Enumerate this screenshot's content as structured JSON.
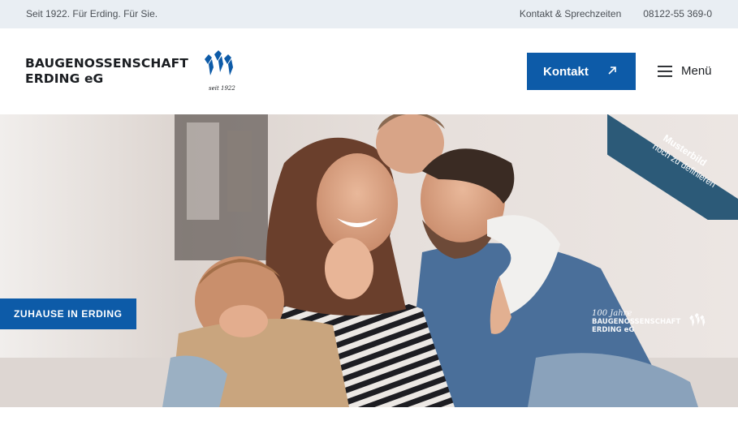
{
  "topbar": {
    "tagline": "Seit 1922. Für Erding. Für Sie.",
    "contact_link": "Kontakt & Sprechzeiten",
    "phone": "08122-55 369-0"
  },
  "header": {
    "brand_line1": "BAUGENOSSENSCHAFT",
    "brand_line2": "ERDING eG",
    "logo_caption": "seit 1922",
    "cta_label": "Kontakt",
    "menu_label": "Menü"
  },
  "hero": {
    "badge": "ZUHAUSE IN ERDING",
    "ribbon_line1": "Musterbild",
    "ribbon_line2": "noch zu definieren",
    "watermark_script": "100 Jahre",
    "watermark_line1": "BAUGENOSSENSCHAFT",
    "watermark_line2": "ERDING eG"
  },
  "colors": {
    "brand_blue": "#0d5ba8",
    "topbar_bg": "#e9eef3",
    "ribbon_bg": "#2c5a78"
  },
  "icons": {
    "logo": "baugenossenschaft-house-marks-icon",
    "cta": "arrow-up-right-icon",
    "menu": "hamburger-icon"
  }
}
